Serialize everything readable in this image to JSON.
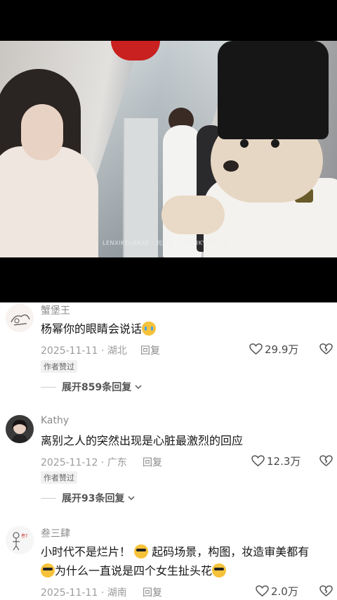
{
  "video": {
    "watermark": "LENXIKYUANXE · 刘湘远 · LENXIKYUANXE"
  },
  "comments": [
    {
      "user": "蟹堡王",
      "text": "杨幂你的眼睛会说话",
      "emoji": "loudly-crying-emoji",
      "date": "2025-11-11",
      "location": "湖北",
      "reply_label": "回复",
      "likes": "29.9万",
      "tag": "作者赞过",
      "expand": "展开859条回复"
    },
    {
      "user": "Kathy",
      "text": "离别之人的突然出现是心脏最激烈的回应",
      "date": "2025-11-12",
      "location": "广东",
      "reply_label": "回复",
      "likes": "12.3万",
      "tag": "作者赞过",
      "expand": "展开93条回复"
    },
    {
      "user": "叁三肆",
      "text_line1_a": "小时代不是烂片！",
      "text_line1_b": "起码场景，构图，妆造审美都有",
      "text_line2": "为什么一直说是四个女生扯头花",
      "date": "2025-11-11",
      "location": "湖南",
      "reply_label": "回复",
      "likes": "2.0万"
    }
  ],
  "icons": {
    "like": "heart-outline-icon",
    "dislike": "broken-heart-icon",
    "expand": "chevron-down-icon"
  }
}
